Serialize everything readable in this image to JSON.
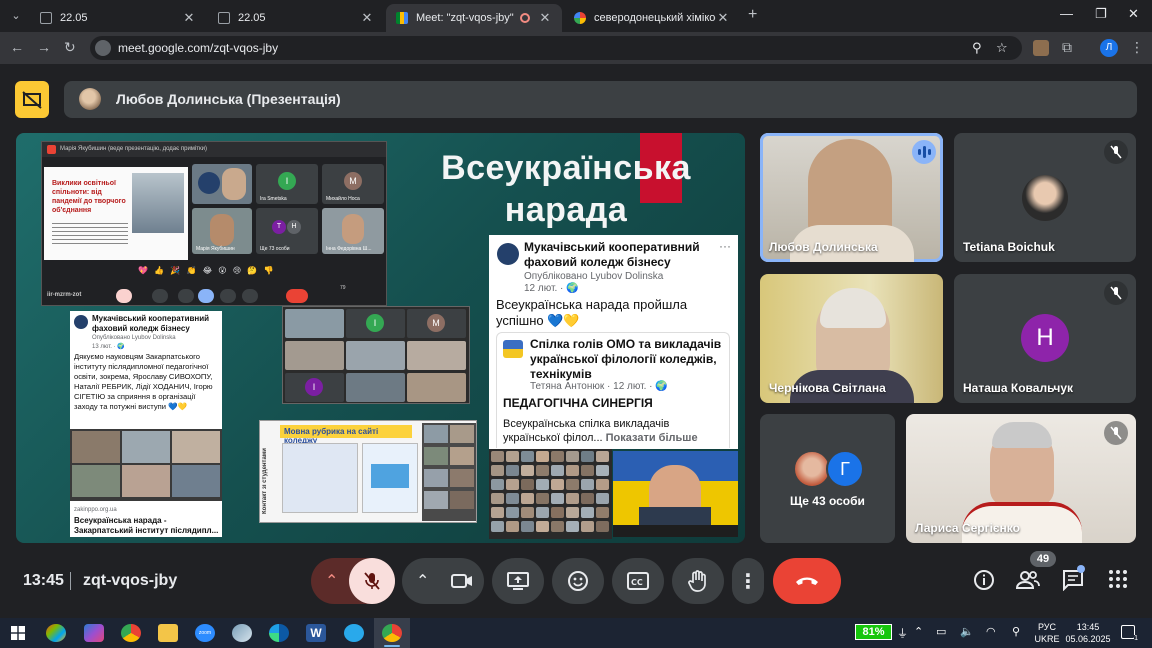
{
  "browser": {
    "tabs": [
      {
        "title": "22.05"
      },
      {
        "title": "22.05"
      },
      {
        "title": "Meet: \"zqt-vqos-jby\""
      },
      {
        "title": "северодонецький хіміко-механ"
      }
    ],
    "url": "meet.google.com/zqt-vqos-jby",
    "profile_initial": "Л"
  },
  "presenter_bar": {
    "title": "Любов Долинська (Презентація)"
  },
  "slide": {
    "title_line1": "Всеукраїнська",
    "title_line2": "нарада",
    "meet_shot": {
      "header": "Марія Якубишин (веде презентацію, додає примітки)",
      "slide_title": "Виклики освітньої спільноти: від пандемії до творчого об'єднання",
      "tiles": [
        {
          "label": "Ira Smetska",
          "initial": "I"
        },
        {
          "label": "Михайло Носа",
          "initial": "M"
        },
        {
          "label": "Марія Якубишин"
        },
        {
          "label": "Ще 73 особи",
          "initials": [
            "T",
            "H"
          ]
        },
        {
          "label": "Інна Федорівна Ш..."
        }
      ],
      "meeting_code": "iir-mzrm-zot",
      "emojis": "💖 👍 🎉 👏 😂 😮 😢 🤔 👎",
      "participants_badge": "79"
    },
    "post_left": {
      "org": "Мукачівський кооперативний фаховий коледж бізнесу",
      "published": "Опубліковано Lyubov Dolinska",
      "date": "13 лют. · 🌍",
      "text": "Дякуємо науковцям Закарпатського інституту післядипломної педагогічної освіти, зокрема, Ярославу СИВОХОПУ, Наталії РЕБРИК, Лідії ХОДАНИЧ, Ігорю СІГЕТІЮ за сприяння в організації заходу та потужні виступи 💙💛",
      "link_domain": "zakinppo.org.ua",
      "link_title": "Всеукраїнська нарада - Закарпатський інститут післядипл..."
    },
    "post_right": {
      "org": "Мукачівський кооперативний фаховий коледж бізнесу",
      "published": "Опубліковано Lyubov Dolinska",
      "date": "12 лют. · 🌍",
      "text": "Всеукраїнська нарада пройшла успішно 💙💛",
      "shared_title": "Спілка голів ОМО та викладачів української філології коледжів, технікумів",
      "shared_author": "Тетяна Антонюк · 12 лют. · 🌍",
      "shared_heading": "ПЕДАГОГІЧНА СИНЕРГІЯ",
      "shared_text": "Всеукраїнська спілка викладачів української філол...",
      "show_more": "Показати більше"
    },
    "rubric": {
      "title": "Мовна рубрика на сайті коледжу",
      "side": "Контакт зі студентами"
    }
  },
  "participants": [
    {
      "name": "Любов Долинська",
      "speaking": true
    },
    {
      "name": "Tetiana Boichuk",
      "muted": true
    },
    {
      "name": "Чернікова Світлана"
    },
    {
      "name": "Наташа Ковальчук",
      "initial": "H",
      "muted": true
    },
    {
      "name": "Ще 43 особи",
      "extra_initial": "Г"
    },
    {
      "name": "Лариса Сергієнко",
      "muted": true
    }
  ],
  "meeting": {
    "time": "13:45",
    "code": "zqt-vqos-jby",
    "participant_count": "49"
  },
  "taskbar": {
    "battery": "81%",
    "lang_line1": "РУС",
    "lang_line2": "UKRE",
    "time": "13:45",
    "date": "05.06.2025",
    "notifications": "1",
    "zoom_label": "zoom"
  },
  "colors": {
    "accent_blue": "#8ab4f8",
    "end_call_red": "#ea4335",
    "present_yellow": "#fcc934",
    "slide_teal": "#1f6d6b",
    "slide_red": "#c8102e"
  },
  "icons": [
    "tab-search-icon",
    "meet-favicon-icon",
    "google-favicon-icon",
    "back-icon",
    "forward-icon",
    "reload-icon",
    "site-info-icon",
    "zoom-icon",
    "bookmark-star-icon",
    "extensions-icon",
    "stop-presenting-icon",
    "mic-off-icon",
    "camera-icon",
    "present-screen-icon",
    "emoji-icon",
    "captions-icon",
    "raise-hand-icon",
    "more-options-icon",
    "end-call-icon",
    "info-icon",
    "people-icon",
    "chat-icon",
    "activities-icon",
    "windows-start-icon"
  ]
}
